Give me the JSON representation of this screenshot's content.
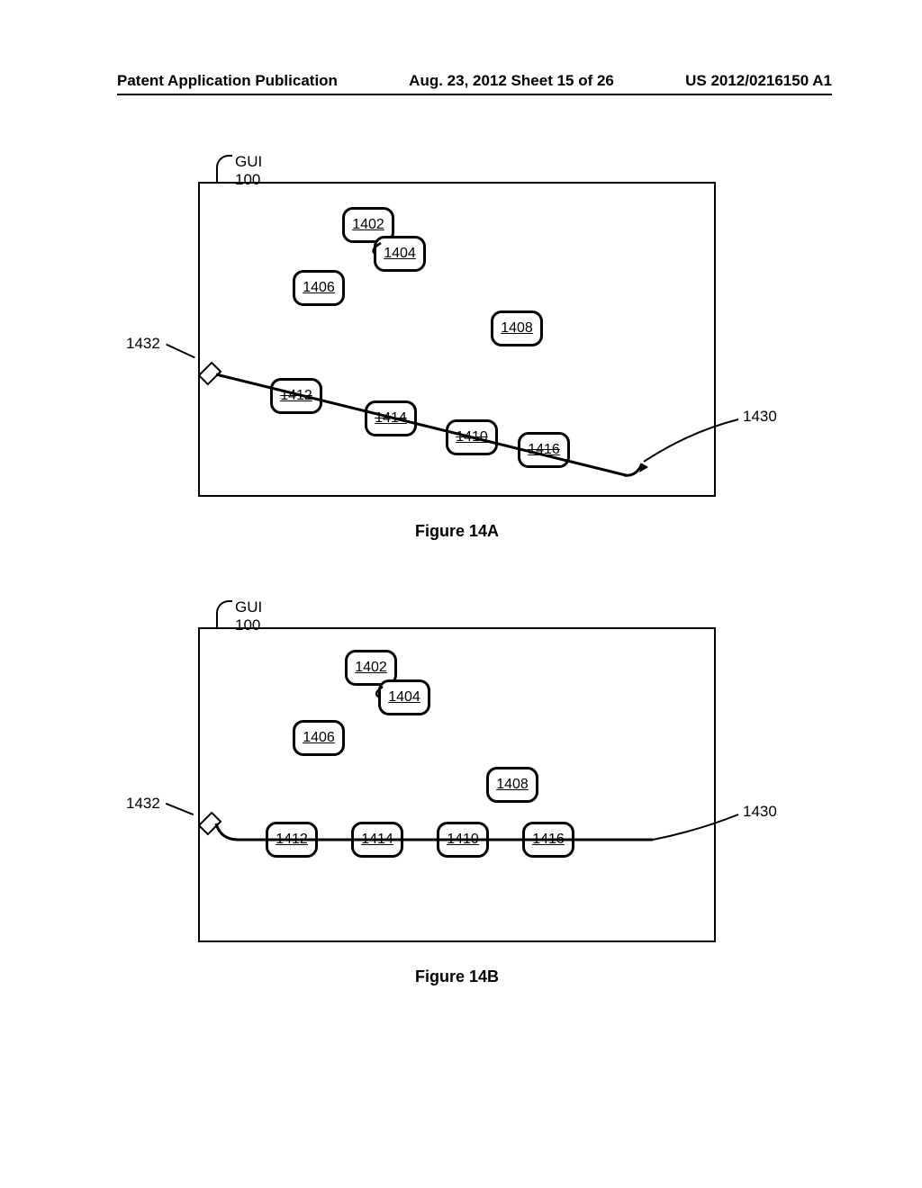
{
  "header": {
    "left": "Patent Application Publication",
    "middle": "Aug. 23, 2012  Sheet 15 of 26",
    "right": "US 2012/0216150 A1"
  },
  "gui_label": "GUI 100",
  "nodes": {
    "n1402": "1402",
    "n1404": "1404",
    "n1406": "1406",
    "n1408": "1408",
    "n1410": "1410",
    "n1412": "1412",
    "n1414": "1414",
    "n1416": "1416"
  },
  "labels": {
    "l1430": "1430",
    "l1432": "1432"
  },
  "captions": {
    "figA": "Figure 14A",
    "figB": "Figure 14B"
  }
}
